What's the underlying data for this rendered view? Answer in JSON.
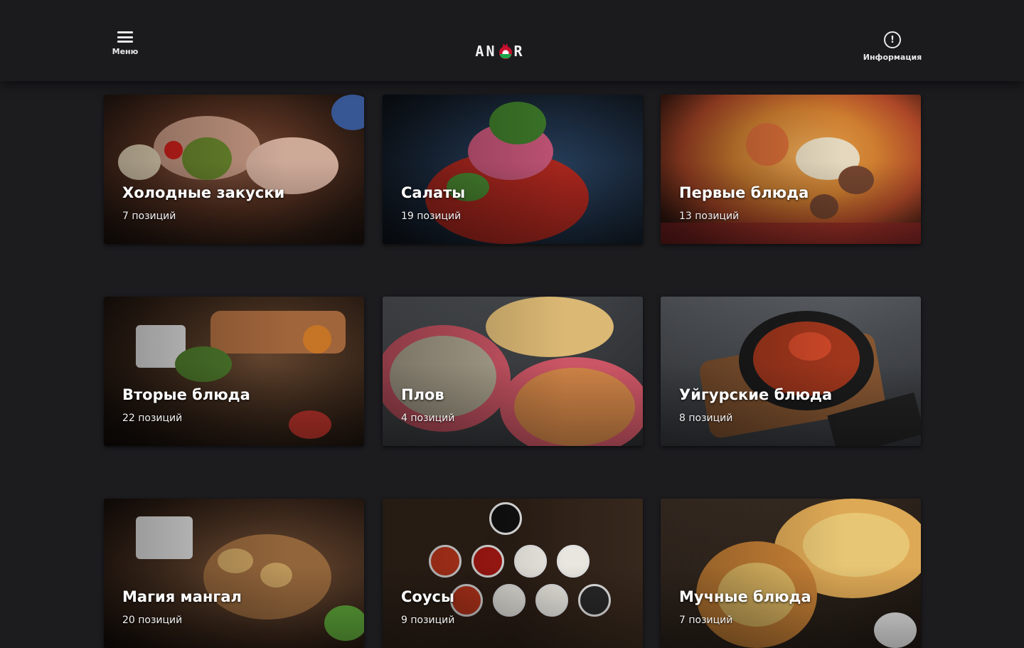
{
  "header": {
    "menu_label": "Меню",
    "logo_text_left": "AN",
    "logo_text_right": "R",
    "info_label": "Информация",
    "info_glyph": "!"
  },
  "categories": [
    {
      "title": "Холодные закуски",
      "count": "7 позиций"
    },
    {
      "title": "Салаты",
      "count": "19 позиций"
    },
    {
      "title": "Первые блюда",
      "count": "13 позиций"
    },
    {
      "title": "Вторые блюда",
      "count": "22 позиций"
    },
    {
      "title": "Плов",
      "count": "4 позиций"
    },
    {
      "title": "Уйгурские блюда",
      "count": "8 позиций"
    },
    {
      "title": "Магия мангал",
      "count": "20 позиций"
    },
    {
      "title": "Соусы",
      "count": "9 позиций"
    },
    {
      "title": "Мучные блюда",
      "count": "7 позиций"
    }
  ],
  "colors": {
    "background": "#1c1c1f",
    "topbar": "#1b1b1e",
    "brand_red": "#c8102e",
    "brand_green": "#1aa64a"
  },
  "icons": {
    "menu": "hamburger-icon",
    "info": "info-icon",
    "logo": "pomegranate-icon"
  }
}
